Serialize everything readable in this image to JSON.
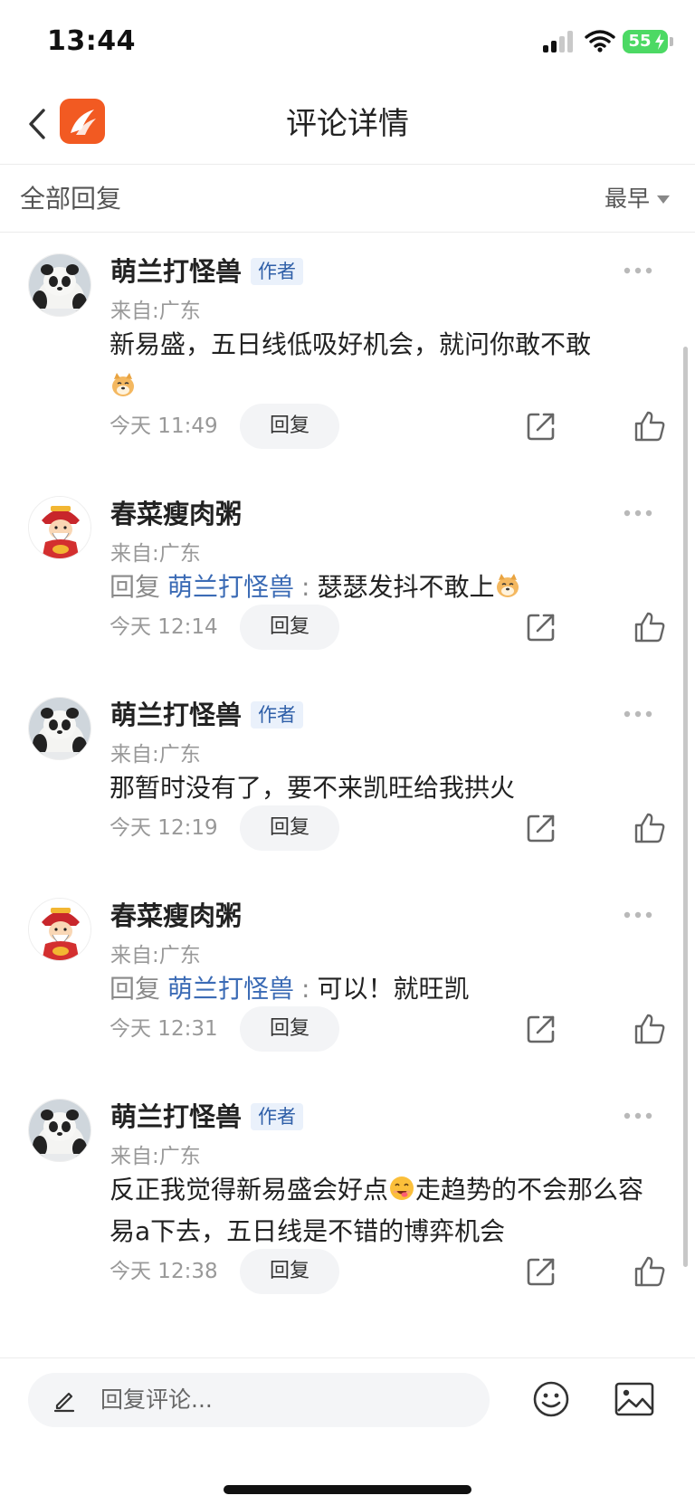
{
  "status_bar": {
    "time": "13:44",
    "battery": "55",
    "icons": [
      "signal-icon",
      "wifi-icon",
      "battery-icon"
    ]
  },
  "header": {
    "title": "评论详情",
    "back_icon": "chevron-left-icon",
    "logo": "app-logo"
  },
  "filter": {
    "title": "全部回复",
    "sort_label": "最早"
  },
  "colors": {
    "accent_link": "#3b6bb5",
    "badge_text": "#2f5fa8",
    "badge_bg": "#eaf1fb",
    "logo": "#f25a22",
    "battery": "#4cd964"
  },
  "comments": [
    {
      "author": "萌兰打怪兽",
      "badge": "作者",
      "avatar": "panda",
      "location": "来自:广东",
      "text": "新易盛，五日线低吸好机会，就问你敢不敢",
      "emoji": "doge-emoji",
      "time": "今天 11:49",
      "reply_label": "回复"
    },
    {
      "author": "春菜瘦肉粥",
      "avatar": "fortune-god",
      "location": "来自:广东",
      "reply_prefix": "回复",
      "reply_to": "萌兰打怪兽",
      "reply_sep": ":",
      "text": "瑟瑟发抖不敢上",
      "emoji": "doge-emoji",
      "time": "今天 12:14",
      "reply_label": "回复"
    },
    {
      "author": "萌兰打怪兽",
      "badge": "作者",
      "avatar": "panda",
      "location": "来自:广东",
      "text": "那暂时没有了，要不来凯旺给我拱火",
      "time": "今天 12:19",
      "reply_label": "回复"
    },
    {
      "author": "春菜瘦肉粥",
      "avatar": "fortune-god",
      "location": "来自:广东",
      "reply_prefix": "回复",
      "reply_to": "萌兰打怪兽",
      "reply_sep": ":",
      "text": "可以！就旺凯",
      "time": "今天 12:31",
      "reply_label": "回复"
    },
    {
      "author": "萌兰打怪兽",
      "badge": "作者",
      "avatar": "panda",
      "location": "来自:广东",
      "text_before": "反正我觉得新易盛会好点",
      "emoji": "drooling-emoji",
      "text_after": "走趋势的不会那么容易a下去，五日线是不错的博弈机会",
      "time": "今天 12:38",
      "reply_label": "回复"
    }
  ],
  "bottom_bar": {
    "input_placeholder": "回复评论...",
    "icons": [
      "pencil-icon",
      "emoji-icon",
      "image-icon"
    ]
  }
}
